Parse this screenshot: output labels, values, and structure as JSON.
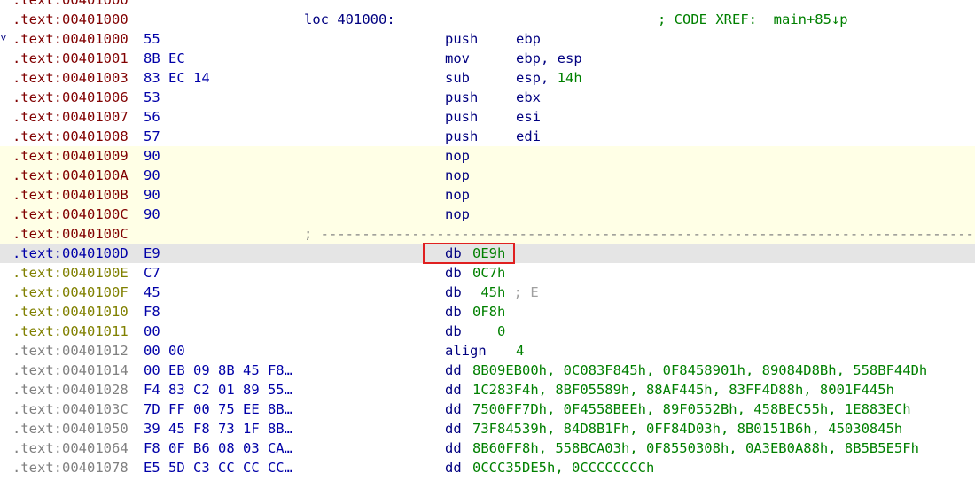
{
  "lines": [
    {
      "addr": ".text:00401000",
      "cls": "c-code",
      "bytes": "",
      "label": "",
      "mnem": "",
      "ops": "",
      "comment": "",
      "partial": true
    },
    {
      "addr": ".text:00401000",
      "cls": "c-code",
      "bytes": "",
      "label": "loc_401000:",
      "mnem": "",
      "ops": "",
      "comment": "; CODE XREF: _main+85↓p"
    },
    {
      "addr": ".text:00401000",
      "cls": "c-code",
      "bytes": "55",
      "mnem": "push",
      "ops": "ebp",
      "arrow": "˅"
    },
    {
      "addr": ".text:00401001",
      "cls": "c-code",
      "bytes": "8B EC",
      "mnem": "mov",
      "ops": "ebp, esp"
    },
    {
      "addr": ".text:00401003",
      "cls": "c-code",
      "bytes": "83 EC 14",
      "mnem": "sub",
      "ops": "esp, ",
      "ops_num": "14h"
    },
    {
      "addr": ".text:00401006",
      "cls": "c-code",
      "bytes": "53",
      "mnem": "push",
      "ops": "ebx"
    },
    {
      "addr": ".text:00401007",
      "cls": "c-code",
      "bytes": "56",
      "mnem": "push",
      "ops": "esi"
    },
    {
      "addr": ".text:00401008",
      "cls": "c-code",
      "bytes": "57",
      "mnem": "push",
      "ops": "edi"
    },
    {
      "addr": ".text:00401009",
      "cls": "c-code",
      "bytes": "90",
      "mnem": "nop",
      "ops": "",
      "hl": "yellow"
    },
    {
      "addr": ".text:0040100A",
      "cls": "c-code",
      "bytes": "90",
      "mnem": "nop",
      "ops": "",
      "hl": "yellow"
    },
    {
      "addr": ".text:0040100B",
      "cls": "c-code",
      "bytes": "90",
      "mnem": "nop",
      "ops": "",
      "hl": "yellow"
    },
    {
      "addr": ".text:0040100C",
      "cls": "c-code",
      "bytes": "90",
      "mnem": "nop",
      "ops": "",
      "hl": "yellow"
    },
    {
      "addr": ".text:0040100C",
      "cls": "c-code",
      "bytes": "",
      "sep": "; -------------------------------------------------------------------------------------------",
      "hl": "yellow"
    },
    {
      "addr": ".text:0040100D",
      "cls": "c-sel",
      "bytes": "E9",
      "mnem": "db",
      "ops_num": "0E9h",
      "hl": "gray",
      "db": true
    },
    {
      "addr": ".text:0040100E",
      "cls": "c-data",
      "bytes": "C7",
      "mnem": "db",
      "ops_num": "0C7h",
      "db": true
    },
    {
      "addr": ".text:0040100F",
      "cls": "c-data",
      "bytes": "45",
      "mnem": "db",
      "ops_num": " 45h",
      "dcomment": " ; E",
      "db": true
    },
    {
      "addr": ".text:00401010",
      "cls": "c-data",
      "bytes": "F8",
      "mnem": "db",
      "ops_num": "0F8h",
      "db": true
    },
    {
      "addr": ".text:00401011",
      "cls": "c-data",
      "bytes": "00",
      "mnem": "db",
      "ops_num": "   0",
      "db": true
    },
    {
      "addr": ".text:00401012",
      "cls": "c-unexp",
      "bytes": "00 00",
      "mnem": "align",
      "ops_num": "4",
      "db": true,
      "align": true
    },
    {
      "addr": ".text:00401014",
      "cls": "c-unexp",
      "bytes": "00 EB 09 8B 45 F8…",
      "mnem": "dd",
      "ops_num": "8B09EB00h, 0C083F845h, 0F8458901h, 89084D8Bh, 558BF44Dh",
      "db": true
    },
    {
      "addr": ".text:00401028",
      "cls": "c-unexp",
      "bytes": "F4 83 C2 01 89 55…",
      "mnem": "dd",
      "ops_num": "1C283F4h, 8BF05589h, 88AF445h, 83FF4D88h, 8001F445h",
      "db": true
    },
    {
      "addr": ".text:0040103C",
      "cls": "c-unexp",
      "bytes": "7D FF 00 75 EE 8B…",
      "mnem": "dd",
      "ops_num": "7500FF7Dh, 0F4558BEEh, 89F0552Bh, 458BEC55h, 1E883ECh",
      "db": true
    },
    {
      "addr": ".text:00401050",
      "cls": "c-unexp",
      "bytes": "39 45 F8 73 1F 8B…",
      "mnem": "dd",
      "ops_num": "73F84539h, 84D8B1Fh, 0FF84D03h, 8B0151B6h, 45030845h",
      "db": true
    },
    {
      "addr": ".text:00401064",
      "cls": "c-unexp",
      "bytes": "F8 0F B6 08 03 CA…",
      "mnem": "dd",
      "ops_num": "8B60FF8h, 558BCA03h, 0F8550308h, 0A3EB0A88h, 8B5B5E5Fh",
      "db": true
    },
    {
      "addr": ".text:00401078",
      "cls": "c-unexp",
      "bytes": "E5 5D C3 CC CC CC…",
      "mnem": "dd",
      "ops_num": "0CCC35DE5h, 0CCCCCCCCh",
      "db": true
    }
  ],
  "colors": {
    "yellow_highlight": "#ffffe6",
    "selected_row": "#e5e5e5",
    "red_box": "#e02020"
  }
}
